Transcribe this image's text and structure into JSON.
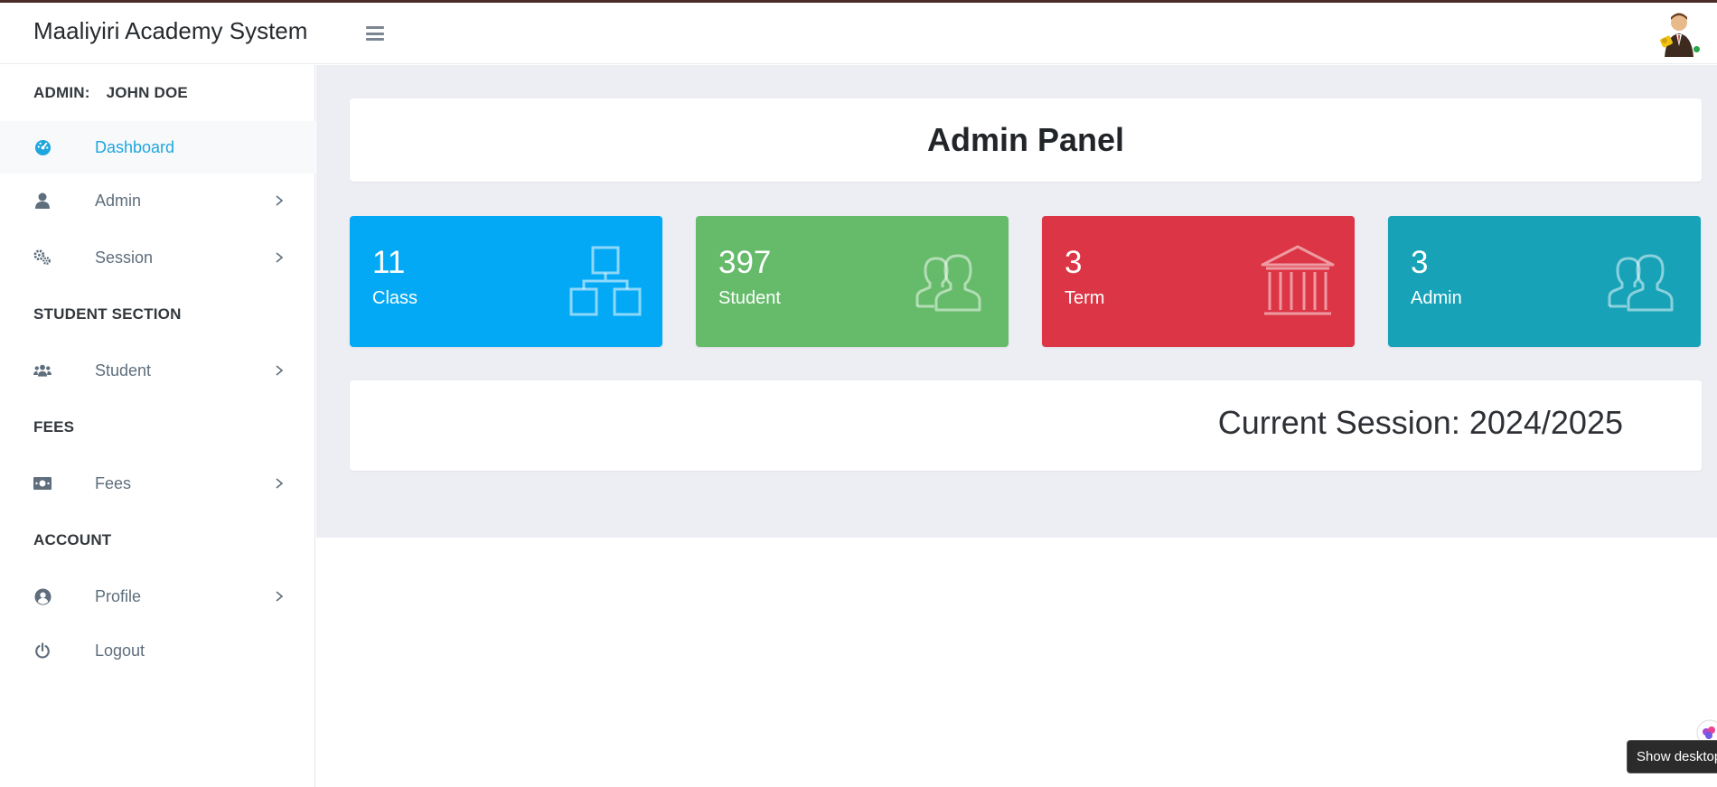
{
  "app": {
    "title": "Maaliyiri Academy System"
  },
  "sidebar": {
    "user_role": "ADMIN:",
    "user_name": "JOHN DOE",
    "items": [
      {
        "label": "Dashboard",
        "icon": "tachometer-icon",
        "active": true
      },
      {
        "label": "Admin",
        "icon": "user-icon",
        "submenu": true
      },
      {
        "label": "Session",
        "icon": "cogs-icon",
        "submenu": true
      },
      {
        "label": "Student",
        "icon": "users-icon",
        "submenu": true
      },
      {
        "label": "Fees",
        "icon": "money-bill-icon",
        "submenu": true
      },
      {
        "label": "Profile",
        "icon": "user-circle-icon",
        "submenu": true
      },
      {
        "label": "Logout",
        "icon": "power-icon"
      }
    ],
    "sections": {
      "student": "STUDENT SECTION",
      "fees": "FEES",
      "account": "ACCOUNT"
    }
  },
  "main": {
    "panel_title": "Admin Panel",
    "stats": [
      {
        "value": "11",
        "label": "Class",
        "color": "#03a9f4",
        "icon": "sitemap-icon"
      },
      {
        "value": "397",
        "label": "Student",
        "color": "#66bb6a",
        "icon": "users-outline-icon"
      },
      {
        "value": "3",
        "label": "Term",
        "color": "#dc3545",
        "icon": "university-icon"
      },
      {
        "value": "3",
        "label": "Admin",
        "color": "#17a2b8",
        "icon": "users-outline-icon"
      }
    ],
    "session_text": "Current Session: 2024/2025"
  },
  "overlay": {
    "tooltip": "Show desktop"
  },
  "colors": {
    "accent": "#1fa6df",
    "sidebar_text": "#5e6e7c",
    "main_bg": "#eceef4"
  }
}
